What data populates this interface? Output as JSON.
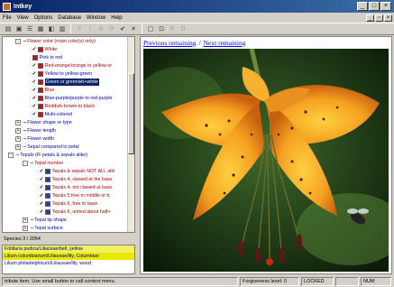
{
  "window": {
    "title": "Intkey"
  },
  "menu": [
    "File",
    "View",
    "Options",
    "Database",
    "Window",
    "Help"
  ],
  "toolbar_icons": [
    "open-icon",
    "save-icon",
    "characters-icon",
    "taxa-icon",
    "restart-icon",
    "find-icon",
    "separate-icon",
    "best-icon",
    "diagnose-icon",
    "use-icon",
    "delete-icon",
    "help-icon",
    "close-icon",
    "info-icon",
    "r-icon",
    "d-icon"
  ],
  "tree": {
    "rows": [
      {
        "indent": 14,
        "exp": "-",
        "check": "",
        "sq": "",
        "label": "Flower color (main color(s) only)",
        "style": "red"
      },
      {
        "indent": 30,
        "exp": "",
        "check": "✓",
        "sq": "red",
        "label": "White",
        "style": "red"
      },
      {
        "indent": 30,
        "exp": "",
        "check": "",
        "sq": "red",
        "label": "Pink to red",
        "style": ""
      },
      {
        "indent": 30,
        "exp": "",
        "check": "✓",
        "sq": "red",
        "label": "Red-orange/orange to yellow-or",
        "style": "red"
      },
      {
        "indent": 30,
        "exp": "",
        "check": "✓",
        "sq": "red",
        "label": "Yellow to yellow-green",
        "style": ""
      },
      {
        "indent": 30,
        "exp": "",
        "check": "✓",
        "sq": "red",
        "label": "Green or greenish+white",
        "style": "hi"
      },
      {
        "indent": 30,
        "exp": "",
        "check": "✓",
        "sq": "red",
        "label": "Blue",
        "style": "red"
      },
      {
        "indent": 30,
        "exp": "",
        "check": "✓",
        "sq": "red",
        "label": "Blue-purple/purple to red-purple",
        "style": ""
      },
      {
        "indent": 30,
        "exp": "",
        "check": "✓",
        "sq": "red",
        "label": "Reddish-brown to black",
        "style": "red"
      },
      {
        "indent": 30,
        "exp": "",
        "check": "✓",
        "sq": "red",
        "label": "Multi-colored",
        "style": ""
      },
      {
        "indent": 14,
        "exp": "+",
        "check": "",
        "sq": "",
        "label": "Flower shape or type",
        "style": ""
      },
      {
        "indent": 14,
        "exp": "+",
        "check": "",
        "sq": "",
        "label": "Flower length",
        "style": ""
      },
      {
        "indent": 14,
        "exp": "+",
        "check": "",
        "sq": "",
        "label": "Flower width",
        "style": ""
      },
      {
        "indent": 14,
        "exp": "+",
        "check": "",
        "sq": "",
        "label": "Sepal compared to petal",
        "style": ""
      },
      {
        "indent": 6,
        "exp": "-",
        "check": "",
        "sq": "",
        "label": "Tepals (IF petals & sepals alike)",
        "style": ""
      },
      {
        "indent": 22,
        "exp": "-",
        "check": "",
        "sq": "",
        "label": "Tepal number",
        "style": "red"
      },
      {
        "indent": 38,
        "exp": "",
        "check": "✓",
        "sq": "blue",
        "label": "Tepals & sepals NOT ALL alik",
        "style": "red"
      },
      {
        "indent": 38,
        "exp": "",
        "check": "✓",
        "sq": "blue",
        "label": "Tepals 4, clawed at the base",
        "style": "red"
      },
      {
        "indent": 38,
        "exp": "",
        "check": "✓",
        "sq": "blue",
        "label": "Tepals 4, not clawed at base",
        "style": "red"
      },
      {
        "indent": 38,
        "exp": "",
        "check": "✓",
        "sq": "blue",
        "label": "Tepals 5,free to middle or b",
        "style": "red"
      },
      {
        "indent": 38,
        "exp": "",
        "check": "✓",
        "sq": "blue",
        "label": "Tepals 6, free to base",
        "style": "red"
      },
      {
        "indent": 38,
        "exp": "",
        "check": "✓",
        "sq": "blue",
        "label": "Tepals 6, united about half+",
        "style": "red"
      },
      {
        "indent": 22,
        "exp": "+",
        "check": "",
        "sq": "",
        "label": "Tepal tip shape",
        "style": ""
      },
      {
        "indent": 22,
        "exp": "+",
        "check": "",
        "sq": "",
        "label": "Tepal surface",
        "style": ""
      }
    ]
  },
  "species": {
    "header": "Species 3 / 2054",
    "items": [
      {
        "label": "Fritillaria pudica/Liliaceae/bell, yellow",
        "style": "sel2"
      },
      {
        "label": "Lilium columbianum/Liliaceae/lily, Columbian",
        "style": "sel"
      },
      {
        "label": "Lilium philadelphicum/Liliaceae/lily, wood",
        "style": ""
      }
    ]
  },
  "viewer": {
    "prev_label": "Previous remaining",
    "separator": "/",
    "next_label": "Next remaining"
  },
  "status": {
    "hint": "tribute item. Use small button to call context menu.",
    "forgiveness": "Forgiveness level: 0",
    "locked": "LOCKED",
    "blank": "",
    "num": "NUM"
  },
  "colors": {
    "titlebar": "#0a246a",
    "petal": "#f0a020",
    "selection": "#e8e800"
  }
}
